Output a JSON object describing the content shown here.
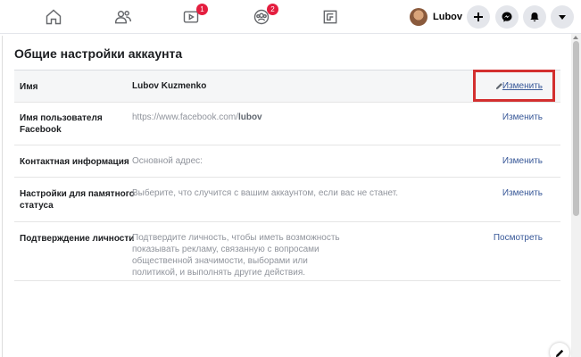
{
  "topbar": {
    "nav": [
      {
        "name": "home-icon",
        "badge": ""
      },
      {
        "name": "friends-icon",
        "badge": ""
      },
      {
        "name": "watch-icon",
        "badge": "1"
      },
      {
        "name": "groups-icon",
        "badge": "2"
      },
      {
        "name": "gaming-icon",
        "badge": ""
      }
    ],
    "profile_name": "Lubov",
    "buttons": [
      "plus-icon",
      "messenger-icon",
      "bell-icon",
      "caret-down-icon"
    ]
  },
  "settings": {
    "title": "Общие настройки аккаунта",
    "rows": [
      {
        "label": "Имя",
        "value": "Lubov Kuzmenko",
        "action": "Изменить"
      },
      {
        "label": "Имя пользователя Facebook",
        "value_prefix": "https://www.facebook.com/",
        "value_bold": "lubov",
        "action": "Изменить"
      },
      {
        "label": "Контактная информация",
        "value": "Основной адрес:",
        "action": "Изменить"
      },
      {
        "label": "Настройки для памятного статуса",
        "value": "Выберите, что случится с вашим аккаунтом, если вас не станет.",
        "action": "Изменить"
      },
      {
        "label": "Подтверждение личности",
        "value": "Подтвердите личность, чтобы иметь возможность показывать рекламу, связанную с вопросами общественной значимости, выборами или политикой, и выполнять другие действия.",
        "action": "Посмотреть"
      }
    ]
  },
  "colors": {
    "link": "#385898",
    "highlight_border": "#d32f2f",
    "badge": "#e41e3f"
  }
}
